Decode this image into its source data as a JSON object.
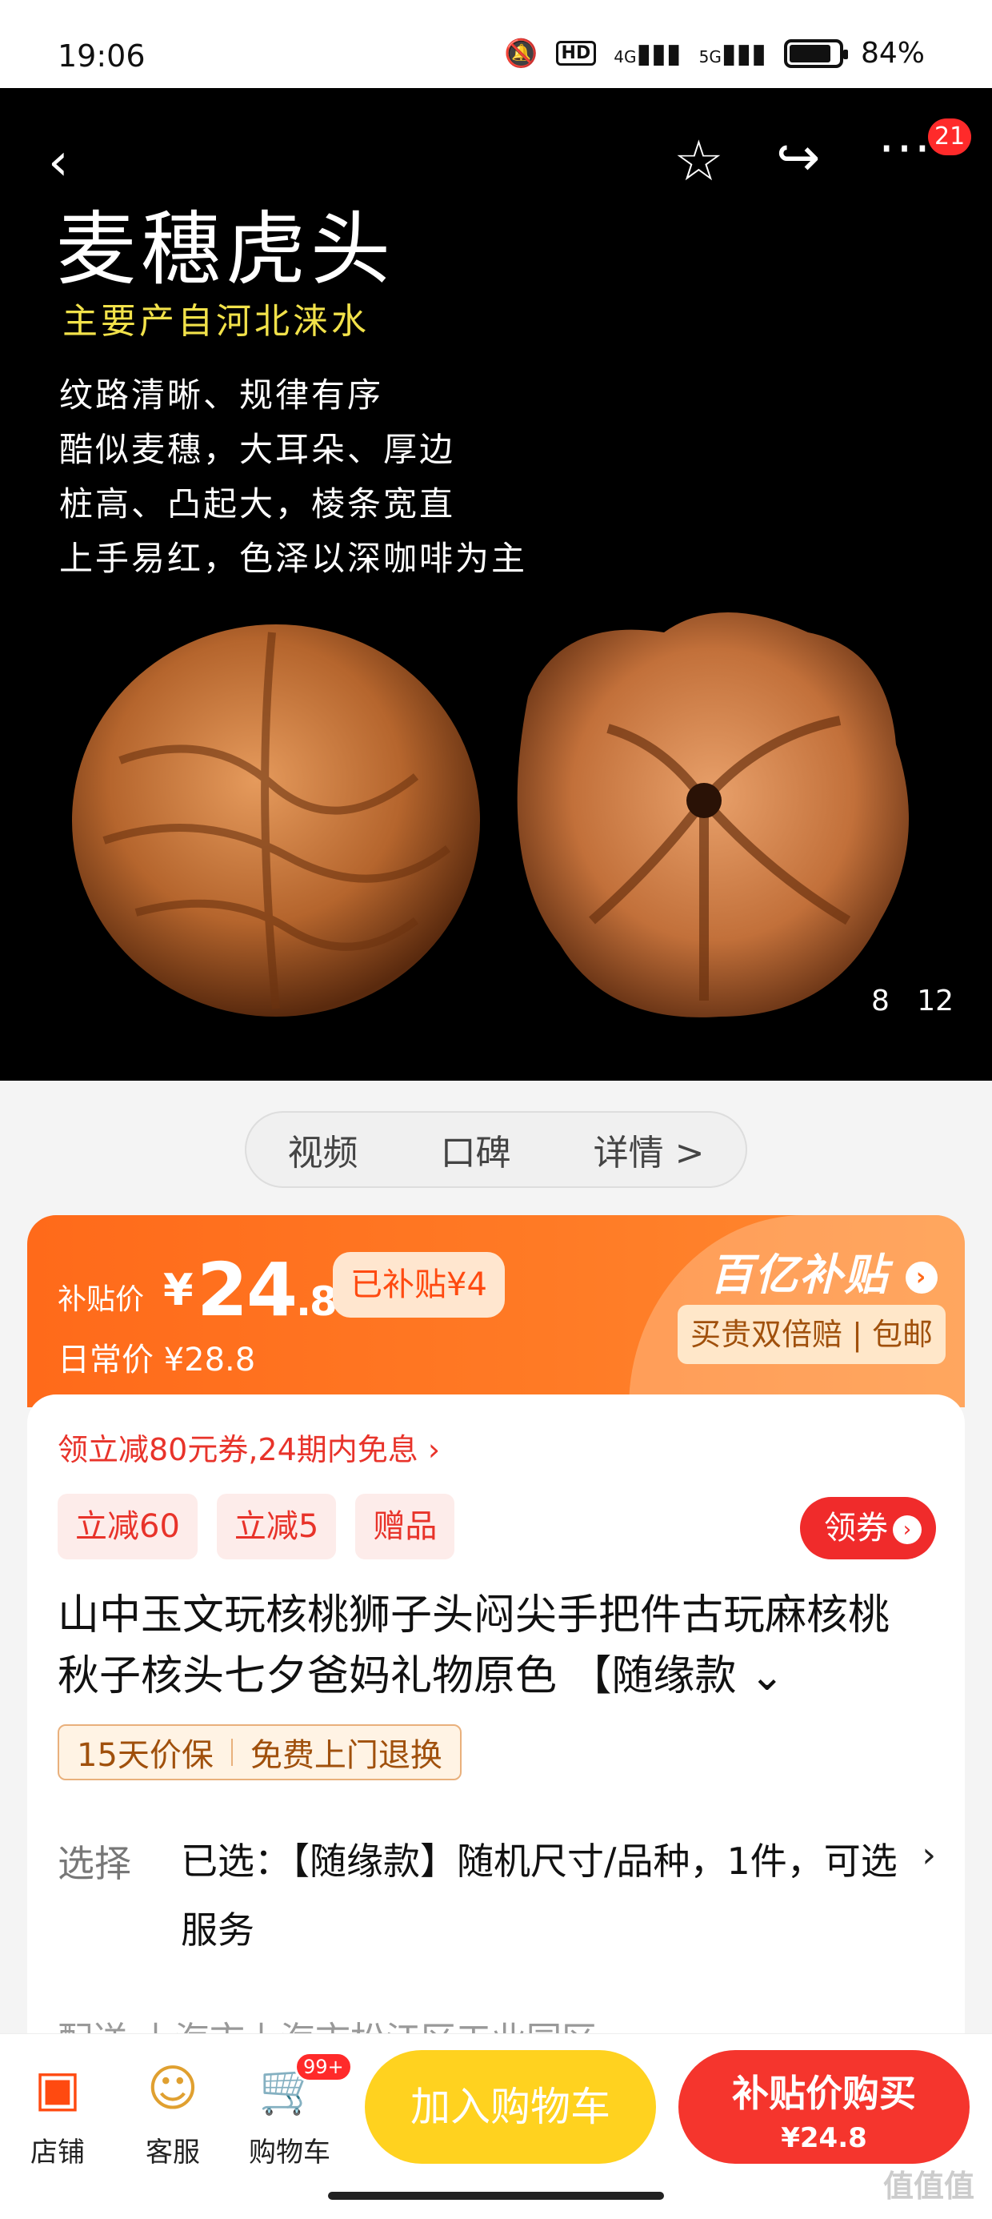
{
  "status_bar": {
    "time": "19:06",
    "mute_icon": "bell-off-icon",
    "hd_label": "HD",
    "network_4g": "4G",
    "network_5g": "5G",
    "battery_percent": "84%",
    "battery_level": 0.84
  },
  "hero": {
    "title": "麦穗虎头",
    "subtitle": "主要产自河北涞水",
    "lines": [
      "纹路清晰、规律有序",
      "酷似麦穗，大耳朵、厚边",
      "桩高、凸起大，棱条宽直",
      "上手易红，色泽以深咖啡为主"
    ],
    "counter_current": "8",
    "counter_total": "12",
    "more_badge": "21"
  },
  "tabs": [
    "视频",
    "口碑",
    "详情 >"
  ],
  "price": {
    "subsidy_label": "补贴价",
    "currency": "¥",
    "amount_main": "24",
    "amount_decimal": ".8",
    "subsidy_tag": "已补贴¥4",
    "regular_label": "日常价 ¥28.8",
    "brand": "百亿补贴",
    "assurance": "买贵双倍赔 | 包邮"
  },
  "info": {
    "coupon_line": "领立减80元券,24期内免息 ›",
    "tags": [
      "立减60",
      "立减5",
      "赠品"
    ],
    "get_coupon": "领券",
    "title": "山中玉文玩核桃狮子头闷尖手把件古玩麻核桃秋子核头七夕爸妈礼物原色 【随缘款 ⌄",
    "services": [
      "15天价保",
      "免费上门退换"
    ],
    "select_label": "选择",
    "select_value": "已选：【随缘款】随机尺寸/品种，1件，可选服务",
    "ship_peek": "配送  上海市上海市松江区工业园区..."
  },
  "bottom_bar": {
    "shop": "店铺",
    "service": "客服",
    "cart": "购物车",
    "cart_badge": "99+",
    "add_to_cart": "加入购物车",
    "buy_line1": "补贴价购买",
    "buy_line2": "¥24.8"
  },
  "watermark": "值值值",
  "colors": {
    "accent_orange": "#ff6a1a",
    "buy_red": "#f5352d",
    "cart_yellow": "#ffd21f"
  }
}
